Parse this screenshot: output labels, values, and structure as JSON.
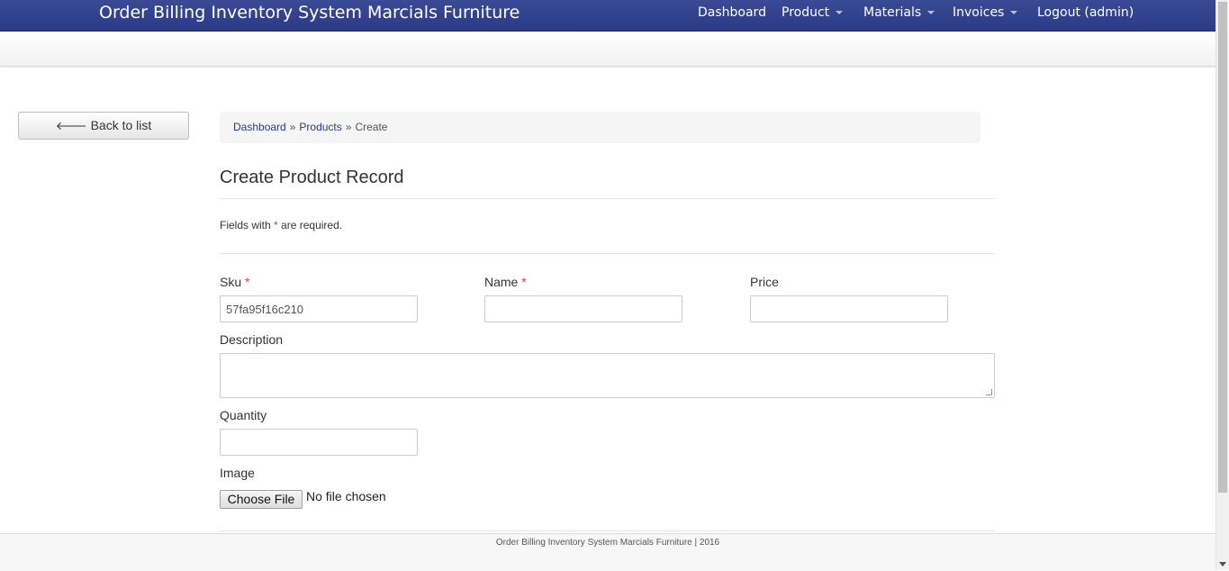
{
  "app": {
    "title": "Order Billing Inventory System Marcials Furniture"
  },
  "nav": {
    "items": [
      {
        "label": "Dashboard",
        "dropdown": false
      },
      {
        "label": "Product",
        "dropdown": true
      },
      {
        "label": "Materials",
        "dropdown": true
      },
      {
        "label": "Invoices",
        "dropdown": true
      },
      {
        "label": "Logout (admin)",
        "dropdown": false
      }
    ]
  },
  "sidebar": {
    "back_label": "Back to list",
    "back_icon": "arrow-left-icon"
  },
  "breadcrumb": {
    "items": [
      "Dashboard",
      "Products",
      "Create"
    ],
    "separator": "»"
  },
  "form": {
    "title": "Create Product Record",
    "note_prefix": "Fields with",
    "note_star": "*",
    "note_suffix": "are required.",
    "fields": {
      "sku": {
        "label": "Sku",
        "required": "*",
        "value": "57fa95f16c210"
      },
      "name": {
        "label": "Name",
        "required": "*",
        "value": ""
      },
      "price": {
        "label": "Price",
        "value": ""
      },
      "description": {
        "label": "Description",
        "value": ""
      },
      "quantity": {
        "label": "Quantity",
        "value": ""
      },
      "image": {
        "label": "Image",
        "button": "Choose File",
        "status": "No file chosen"
      }
    }
  },
  "footer": {
    "text": "Order Billing Inventory System Marcials Furniture | 2016"
  },
  "colors": {
    "navbar": "#2e3d8a",
    "link": "#2c3a80",
    "required": "#b94a48"
  }
}
